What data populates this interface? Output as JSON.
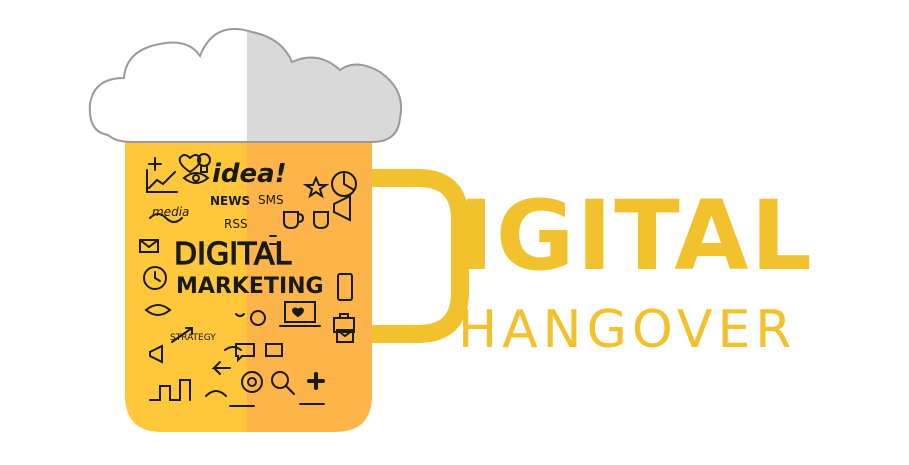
{
  "logo": {
    "name": "Digital Hangover",
    "brand_word_initial": "D",
    "brand_word_rest": "IGITAL",
    "brand_word_2": "HANGOVER",
    "mug_words": {
      "idea": "idea!",
      "news": "NEWS",
      "sms": "SMS",
      "media": "media",
      "rss": "RSS",
      "digital": "DIGITAL",
      "marketing": "MARKETING",
      "strategy": "STRATEGY"
    }
  },
  "colors": {
    "beer_light": "#ffc73b",
    "beer_dark": "#fdb44a",
    "handle": "#f2c12e",
    "foam_light": "#ffffff",
    "foam_shadow": "#d9d9d9",
    "foam_outline": "#9a9a9a",
    "doodle_ink": "#1a1a1a"
  },
  "icons": [
    "plus-icon",
    "chart-icon",
    "heart-icon",
    "eye-icon",
    "lightbulb-icon",
    "star-icon",
    "pie-chart-icon",
    "coffee-cup-icon",
    "megaphone-icon",
    "alarm-clock-icon",
    "envelope-icon",
    "phone-icon",
    "laptop-icon",
    "briefcase-icon",
    "magnifier-icon",
    "target-icon",
    "arrow-icon",
    "speech-bubble-icon",
    "cross-icon"
  ]
}
